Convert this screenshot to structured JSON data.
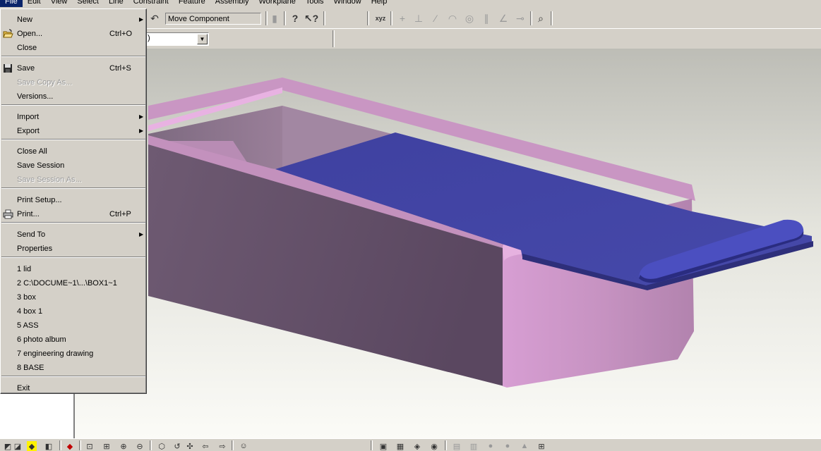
{
  "menubar": {
    "items": [
      "File",
      "Edit",
      "View",
      "Select",
      "Line",
      "Constraint",
      "Feature",
      "Assembly",
      "Workplane",
      "Tools",
      "Window",
      "Help"
    ]
  },
  "toolbar": {
    "command_text": "Move Component",
    "icons": [
      "undo-icon",
      "component-icon",
      "help-icon",
      "whats-this-icon",
      "xyz-axis-icon",
      "pin-icon",
      "perpendicular-icon",
      "line-icon",
      "arc-icon",
      "concentric-icon",
      "parallel-icon",
      "angle-icon",
      "tangent-icon",
      "zoom-icon"
    ]
  },
  "toolbar2": {
    "combo_value": ")"
  },
  "file_menu": {
    "items": [
      {
        "label": "New",
        "shortcut": "",
        "submenu": true,
        "disabled": false
      },
      {
        "label": "Open...",
        "shortcut": "Ctrl+O",
        "submenu": false,
        "disabled": false,
        "icon": "open-folder-icon"
      },
      {
        "label": "Close",
        "shortcut": "",
        "submenu": false,
        "disabled": false
      },
      {
        "label": "Save",
        "shortcut": "Ctrl+S",
        "submenu": false,
        "disabled": false,
        "icon": "floppy-disk-icon"
      },
      {
        "label": "Save Copy As...",
        "shortcut": "",
        "submenu": false,
        "disabled": true
      },
      {
        "label": "Versions...",
        "shortcut": "",
        "submenu": false,
        "disabled": false
      },
      {
        "label": "Import",
        "shortcut": "",
        "submenu": true,
        "disabled": false
      },
      {
        "label": "Export",
        "shortcut": "",
        "submenu": true,
        "disabled": false
      },
      {
        "label": "Close All",
        "shortcut": "",
        "submenu": false,
        "disabled": false
      },
      {
        "label": "Save Session",
        "shortcut": "",
        "submenu": false,
        "disabled": false
      },
      {
        "label": "Save Session As...",
        "shortcut": "",
        "submenu": false,
        "disabled": true
      },
      {
        "label": "Print Setup...",
        "shortcut": "",
        "submenu": false,
        "disabled": false
      },
      {
        "label": "Print...",
        "shortcut": "Ctrl+P",
        "submenu": false,
        "disabled": false,
        "icon": "printer-icon"
      },
      {
        "label": "Send To",
        "shortcut": "",
        "submenu": true,
        "disabled": false
      },
      {
        "label": "Properties",
        "shortcut": "",
        "submenu": false,
        "disabled": false
      },
      {
        "label": "1 lid",
        "shortcut": "",
        "submenu": false,
        "disabled": false
      },
      {
        "label": "2 C:\\DOCUME~1\\...\\BOX1~1",
        "shortcut": "",
        "submenu": false,
        "disabled": false
      },
      {
        "label": "3 box",
        "shortcut": "",
        "submenu": false,
        "disabled": false
      },
      {
        "label": "4 box 1",
        "shortcut": "",
        "submenu": false,
        "disabled": false
      },
      {
        "label": "5 ASS",
        "shortcut": "",
        "submenu": false,
        "disabled": false
      },
      {
        "label": "6 photo album",
        "shortcut": "",
        "submenu": false,
        "disabled": false
      },
      {
        "label": "7 engineering drawing",
        "shortcut": "",
        "submenu": false,
        "disabled": false
      },
      {
        "label": "8 BASE",
        "shortcut": "",
        "submenu": false,
        "disabled": false
      },
      {
        "label": "Exit",
        "shortcut": "",
        "submenu": false,
        "disabled": false
      }
    ]
  },
  "colors": {
    "menu_bg": "#d4d0c8",
    "highlight": "#0a246a",
    "box_pink": "#c591bf",
    "lid_blue": "#4446a2"
  }
}
